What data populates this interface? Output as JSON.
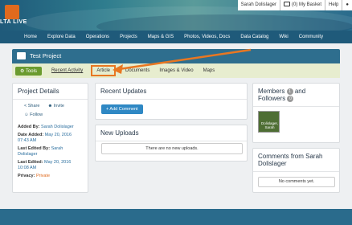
{
  "header": {
    "logo_text": "LTA LIVE",
    "user_name": "Sarah Dolislager",
    "basket_label": "(0) My Basket",
    "help_label": "Help"
  },
  "nav": {
    "items": [
      "Home",
      "Explore Data",
      "Operations",
      "Projects",
      "Maps & GIS",
      "Photos, Videos, Docs",
      "Data Catalog",
      "Wiki",
      "Community"
    ]
  },
  "project": {
    "title": "Test Project",
    "tools_label": "Tools",
    "tabs": [
      "Recent Activity",
      "Article",
      "Documents",
      "Images & Video",
      "Maps"
    ]
  },
  "details": {
    "heading": "Project Details",
    "share": "Share",
    "invite": "Invite",
    "follow": "Follow",
    "added_by_label": "Added By:",
    "added_by": "Sarah Dolislager",
    "date_added_label": "Date Added:",
    "date_added": "May 20, 2016 07:43 AM",
    "last_edited_by_label": "Last Edited By:",
    "last_edited_by": "Sarah Dolislager",
    "last_edited_label": "Last Edited:",
    "last_edited": "May 20, 2016 10:08 AM",
    "privacy_label": "Privacy:",
    "privacy": "Private"
  },
  "updates": {
    "heading": "Recent Updates",
    "add_comment": "+ Add Comment"
  },
  "uploads": {
    "heading": "New Uploads",
    "empty": "There are no new uploads."
  },
  "members": {
    "members_label": "Members",
    "members_count": "1",
    "and": "and",
    "followers_label": "Followers",
    "followers_count": "0",
    "avatar_name": "Dolislager, Sarah"
  },
  "comments": {
    "heading": "Comments from Sarah Dolislager",
    "empty": "No comments yet."
  },
  "colors": {
    "accent_orange": "#e87722",
    "nav_bg": "#1f5a7a",
    "tools_green": "#6b9b2e",
    "button_blue": "#2f88c4"
  }
}
